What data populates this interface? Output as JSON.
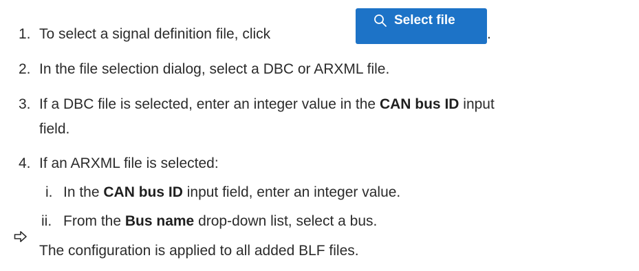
{
  "steps": [
    {
      "number": "1.",
      "text_before": "To select a signal definition file, click",
      "text_after": "."
    },
    {
      "number": "2.",
      "text": "In the file selection dialog, select a DBC or ARXML file."
    },
    {
      "number": "3.",
      "text_before": "If a DBC file is selected, enter an integer value in the ",
      "bold": "CAN bus ID",
      "text_after": " input",
      "continuation": "field."
    },
    {
      "number": "4.",
      "text": "If an ARXML file is selected:"
    }
  ],
  "substeps": [
    {
      "number": "i.",
      "text_before": "In the ",
      "bold": "CAN bus ID",
      "text_after": " input field, enter an integer value."
    },
    {
      "number": "ii.",
      "text_before": "From the ",
      "bold": "Bus name",
      "text_after": " drop-down list, select a bus."
    }
  ],
  "result": {
    "icon": "result-arrow-icon",
    "text": "The configuration is applied to all added BLF files."
  },
  "select_button": {
    "label": "Select file",
    "icon": "search-icon",
    "color": "#1d73c7"
  }
}
